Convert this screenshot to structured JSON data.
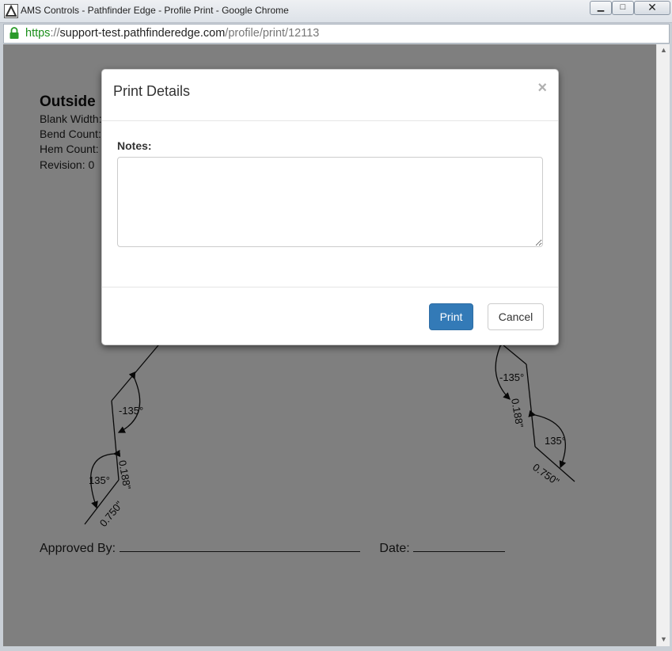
{
  "window": {
    "title": "AMS Controls - Pathfinder Edge - Profile Print - Google Chrome",
    "minimize": "▁",
    "maximize": "□",
    "close": "✕"
  },
  "address": {
    "scheme": "https",
    "sep": "://",
    "host": "support-test.pathfinderedge.com",
    "path": "/profile/print/12113"
  },
  "page": {
    "title": "Outside",
    "meta": [
      "Blank Width:",
      "Bend Count:",
      "Hem Count:",
      "Revision: 0"
    ],
    "approved_by": "Approved By:",
    "date": "Date:"
  },
  "drawing_labels": {
    "left_angle_1": "-135°",
    "left_dim_1": "0.188\"",
    "left_angle_2": "135°",
    "left_dim_2": "0.750\"",
    "right_angle_1": "-135°",
    "right_dim_1": "0.188\"",
    "right_angle_2": "135°",
    "right_dim_2": "0.750\""
  },
  "modal": {
    "title": "Print Details",
    "close": "×",
    "notes_label": "Notes:",
    "notes_value": "",
    "print_button": "Print",
    "cancel_button": "Cancel"
  },
  "colors": {
    "primary": "#337ab7",
    "backdrop": "rgba(0,0,0,0.5)"
  }
}
